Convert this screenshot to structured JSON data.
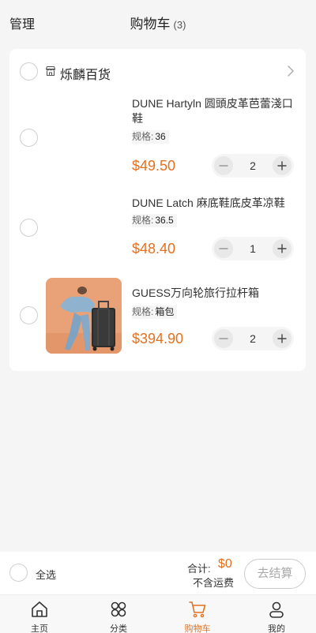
{
  "header": {
    "manage_label": "管理",
    "title": "购物车",
    "count": "(3)"
  },
  "shop": {
    "name": "烁麟百货"
  },
  "items": [
    {
      "name": "DUNE Hartyln 圆頭皮革芭蕾淺口鞋",
      "spec_label": "规格:",
      "spec_value": "36",
      "price": "$49.50",
      "quantity": "2",
      "has_image": false
    },
    {
      "name": "DUNE Latch 麻底鞋底皮革凉鞋",
      "spec_label": "规格:",
      "spec_value": "36.5",
      "price": "$48.40",
      "quantity": "1",
      "has_image": false
    },
    {
      "name": "GUESS万向轮旅行拉杆箱",
      "spec_label": "规格:",
      "spec_value": "箱包",
      "price": "$394.90",
      "quantity": "2",
      "has_image": true
    }
  ],
  "footer": {
    "select_all_label": "全选",
    "total_label": "合计:",
    "total_value": "$0",
    "shipping_note": "不含运费",
    "checkout_label": "去结算"
  },
  "tabbar": {
    "tabs": [
      {
        "label": "主页",
        "icon": "home-icon",
        "active": false
      },
      {
        "label": "分类",
        "icon": "category-icon",
        "active": false
      },
      {
        "label": "购物车",
        "icon": "cart-icon",
        "active": true
      },
      {
        "label": "我的",
        "icon": "user-icon",
        "active": false
      }
    ]
  },
  "colors": {
    "accent": "#e5701f",
    "background": "#f5f5f5",
    "card": "#ffffff"
  }
}
